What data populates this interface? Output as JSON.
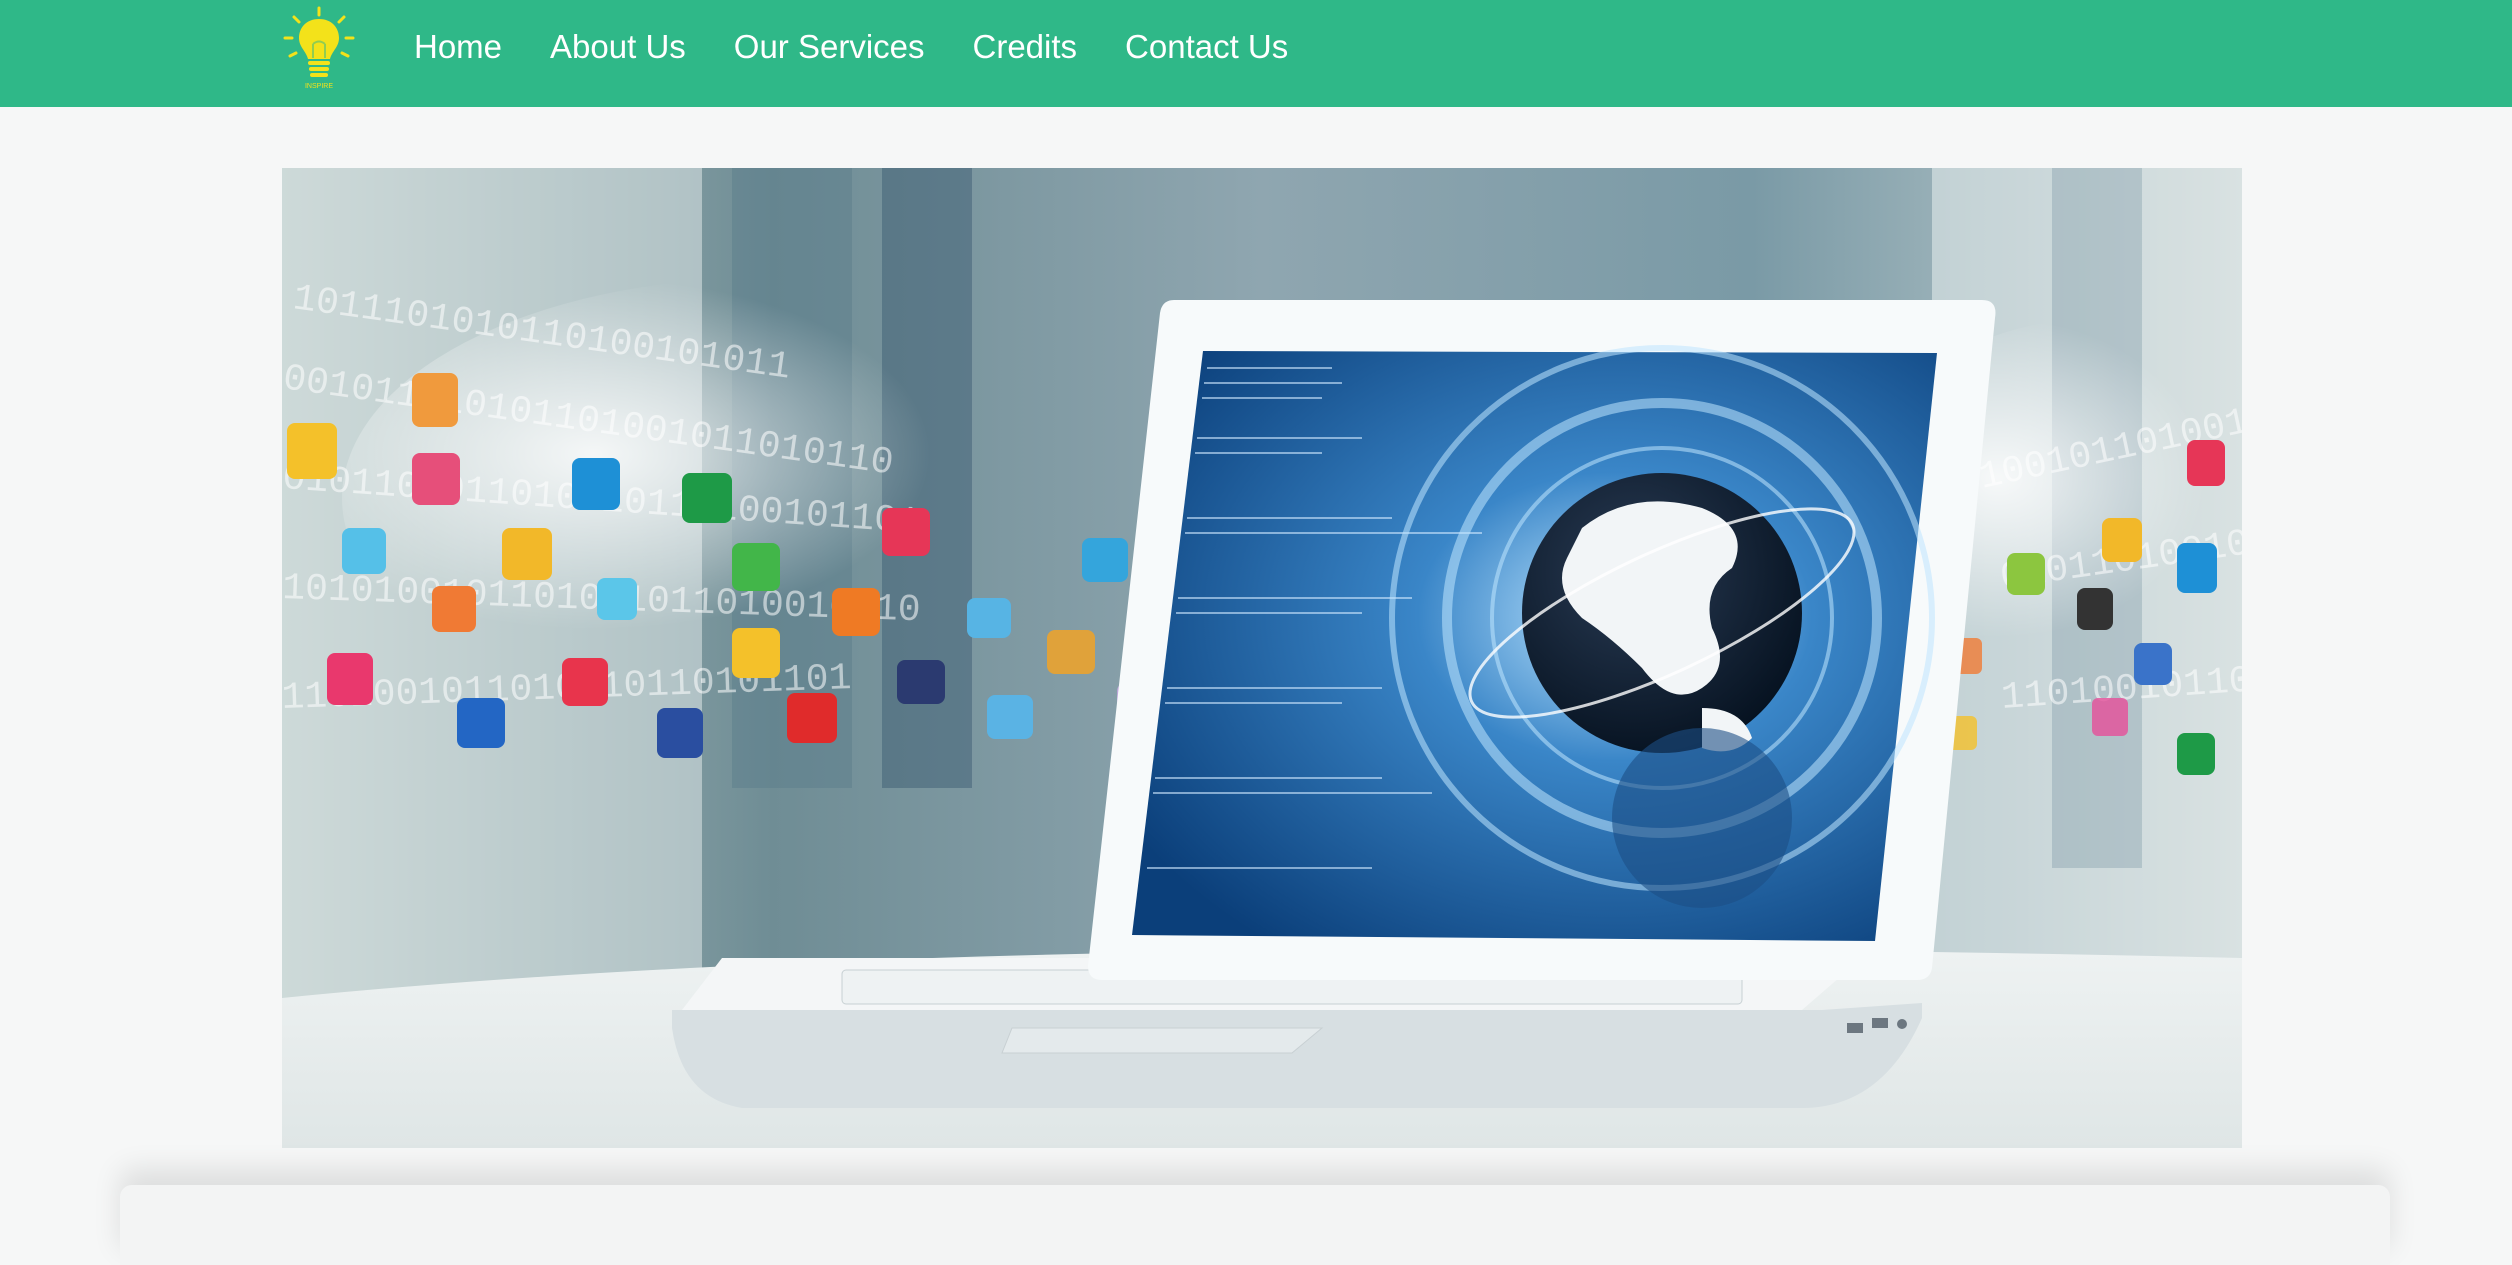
{
  "header": {
    "logo_icon": "lightbulb-icon",
    "logo_text": "INSPIRE",
    "background_color": "#2fb888",
    "nav": [
      {
        "label": "Home"
      },
      {
        "label": "About Us"
      },
      {
        "label": "Our Services"
      },
      {
        "label": "Credits"
      },
      {
        "label": "Contact Us"
      }
    ]
  },
  "hero": {
    "image_subject": "laptop with globe on screen and floating app icons"
  },
  "colors": {
    "page_background": "#f6f7f7",
    "nav_text": "#ffffff",
    "accent_green": "#2fb888",
    "logo_yellow": "#f3e21a"
  }
}
